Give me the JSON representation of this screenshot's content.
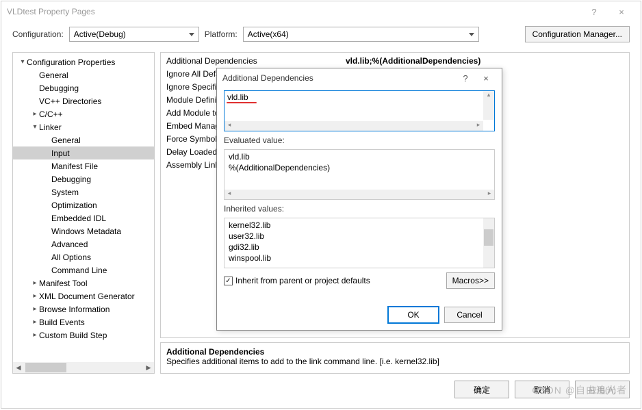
{
  "window": {
    "title": "VLDtest Property Pages",
    "help_icon": "?",
    "close_icon": "×"
  },
  "config_row": {
    "config_label": "Configuration:",
    "config_value": "Active(Debug)",
    "platform_label": "Platform:",
    "platform_value": "Active(x64)",
    "cfgmgr_label": "Configuration Manager..."
  },
  "tree": {
    "root": {
      "label": "Configuration Properties",
      "expanded": true
    },
    "items_top": [
      "General",
      "Debugging",
      "VC++ Directories"
    ],
    "cpp": {
      "label": "C/C++",
      "expanded": false
    },
    "linker": {
      "label": "Linker",
      "expanded": true
    },
    "linker_children": [
      "General",
      "Input",
      "Manifest File",
      "Debugging",
      "System",
      "Optimization",
      "Embedded IDL",
      "Windows Metadata",
      "Advanced",
      "All Options",
      "Command Line"
    ],
    "items_bottom": [
      "Manifest Tool",
      "XML Document Generator",
      "Browse Information",
      "Build Events",
      "Custom Build Step"
    ],
    "selected": "Input"
  },
  "properties": [
    {
      "label": "Additional Dependencies",
      "value": "vld.lib;%(AdditionalDependencies)"
    },
    {
      "label": "Ignore All Default Libraries",
      "value": ""
    },
    {
      "label": "Ignore Specific Default Libraries",
      "value": ""
    },
    {
      "label": "Module Definition File",
      "value": ""
    },
    {
      "label": "Add Module to Assembly",
      "value": ""
    },
    {
      "label": "Embed Managed Resource File",
      "value": ""
    },
    {
      "label": "Force Symbol References",
      "value": ""
    },
    {
      "label": "Delay Loaded Dlls",
      "value": ""
    },
    {
      "label": "Assembly Link Resource",
      "value": ""
    }
  ],
  "help": {
    "title": "Additional Dependencies",
    "desc": "Specifies additional items to add to the link command line. [i.e. kernel32.lib]"
  },
  "footer": {
    "ok": "确定",
    "cancel": "取消",
    "apply": "应用(A)"
  },
  "modal": {
    "title": "Additional Dependencies",
    "help_icon": "?",
    "close_icon": "×",
    "edit_value": "vld.lib",
    "evaluated_label": "Evaluated value:",
    "evaluated_lines": [
      "vld.lib",
      "%(AdditionalDependencies)"
    ],
    "inherited_label": "Inherited values:",
    "inherited_lines": [
      "kernel32.lib",
      "user32.lib",
      "gdi32.lib",
      "winspool.lib"
    ],
    "inherit_checkbox": {
      "checked": true,
      "label": "Inherit from parent or project defaults"
    },
    "macros_label": "Macros>>",
    "ok_label": "OK",
    "cancel_label": "Cancel"
  },
  "watermark": "CSDN @自由追光者"
}
